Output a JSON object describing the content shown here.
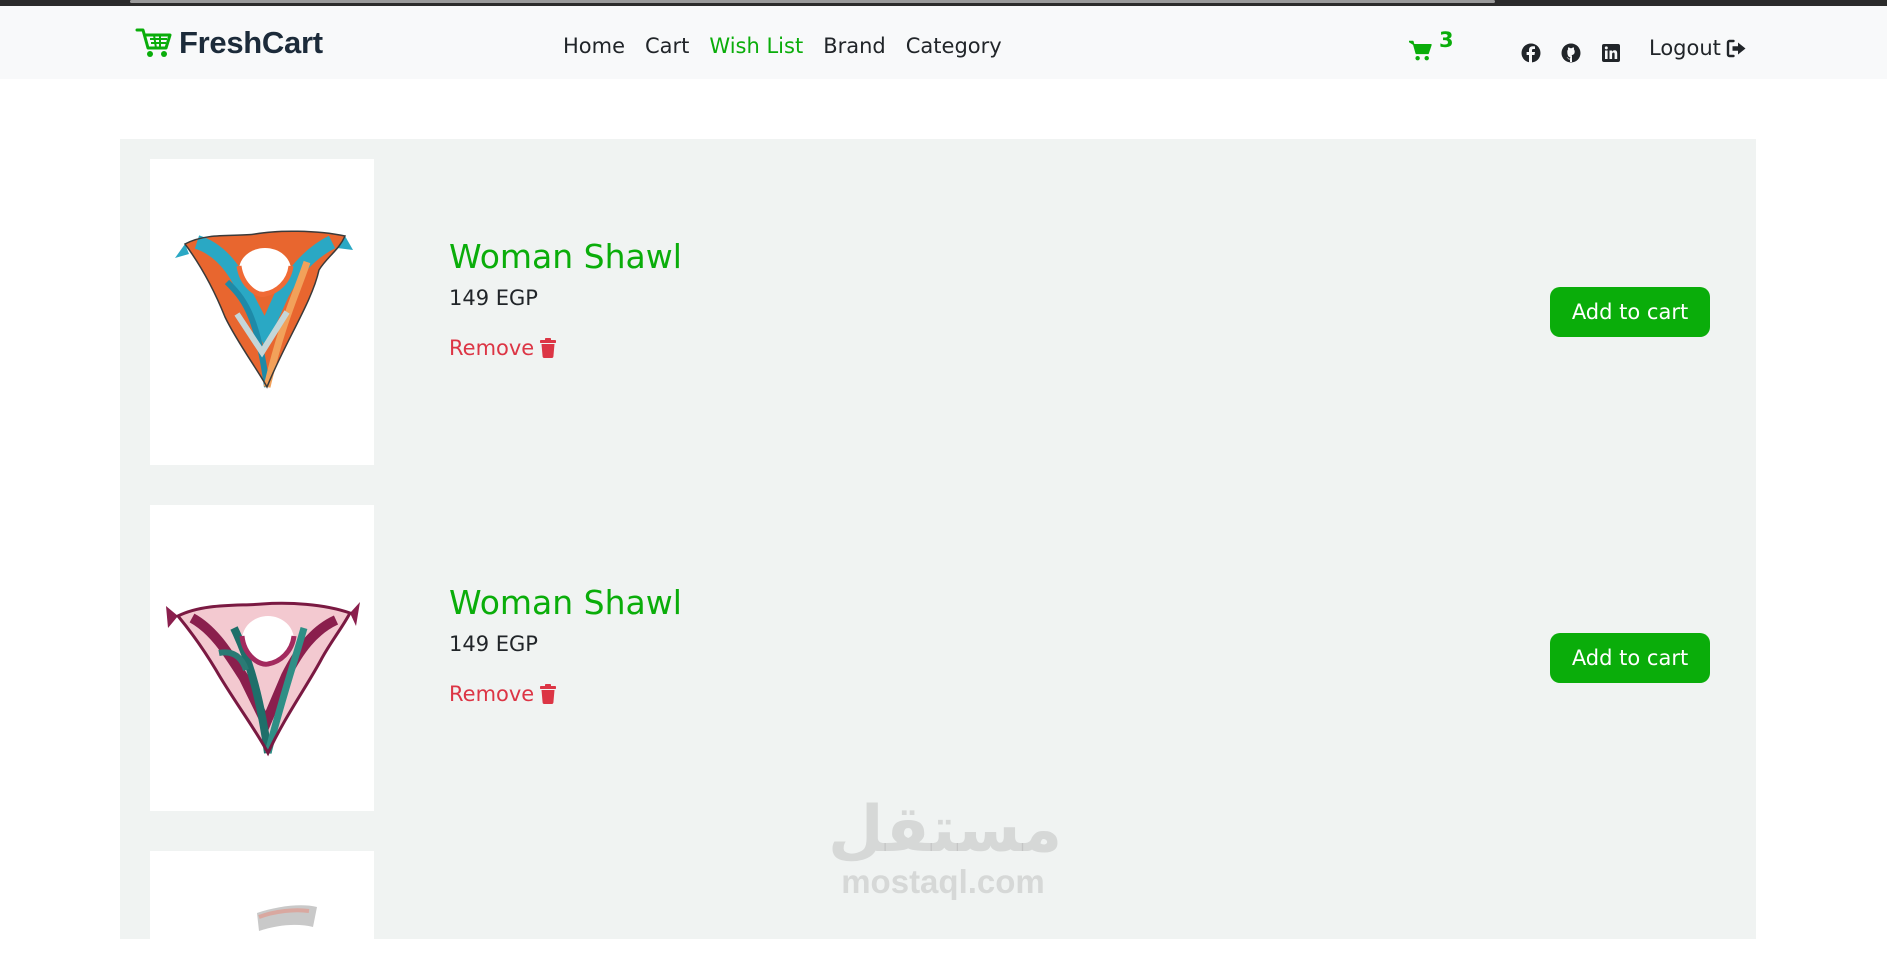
{
  "navbar": {
    "brand": "FreshCart",
    "links": [
      {
        "label": "Home",
        "active": false
      },
      {
        "label": "Cart",
        "active": false
      },
      {
        "label": "Wish List",
        "active": true
      },
      {
        "label": "Brand",
        "active": false
      },
      {
        "label": "Category",
        "active": false
      }
    ],
    "cart_count": "3",
    "social_icons": [
      "facebook-icon",
      "github-icon",
      "linkedin-icon"
    ],
    "logout_label": "Logout"
  },
  "wishlist": {
    "items": [
      {
        "title": "Woman Shawl",
        "price": "149 EGP",
        "remove_label": "Remove",
        "add_label": "Add to cart",
        "image": "orange-teal-shawl"
      },
      {
        "title": "Woman Shawl",
        "price": "149 EGP",
        "remove_label": "Remove",
        "add_label": "Add to cart",
        "image": "pink-magenta-shawl"
      },
      {
        "title": "",
        "price": "",
        "remove_label": "",
        "add_label": "",
        "image": "grey-shawl-partial"
      }
    ]
  },
  "watermark": {
    "arabic": "مستقل",
    "latin": "mostaql.com"
  },
  "colors": {
    "accent": "#0aad0a",
    "danger": "#dc3545",
    "panel": "#f0f3f2",
    "navbar": "#f8f9fa"
  }
}
